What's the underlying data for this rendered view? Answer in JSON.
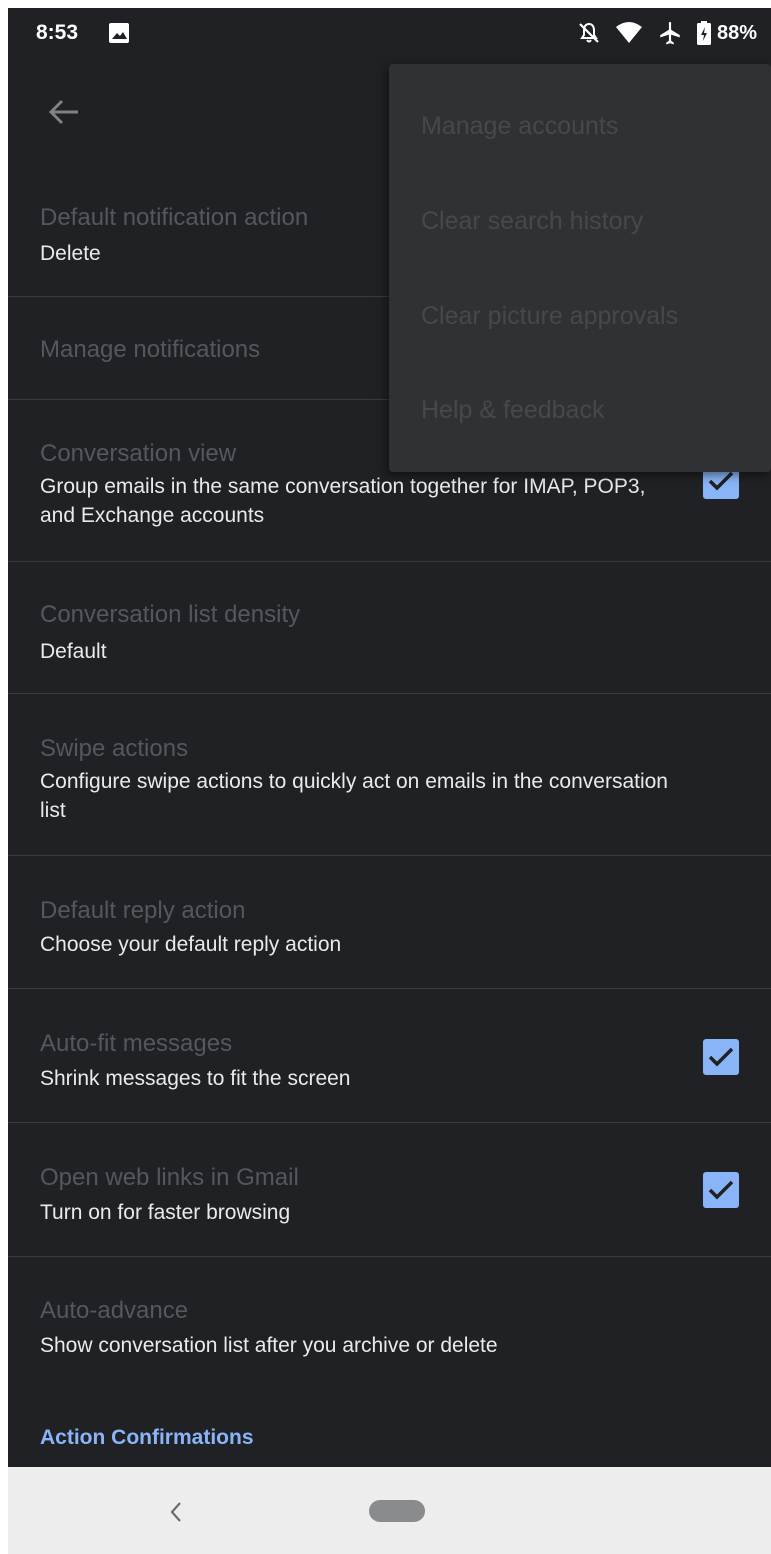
{
  "status_bar": {
    "time": "8:53",
    "battery": "88%",
    "icons": [
      "image-icon",
      "notifications-off-icon",
      "wifi-icon",
      "airplane-mode-icon",
      "battery-icon"
    ]
  },
  "app_bar": {
    "back_icon": "back-arrow-icon"
  },
  "settings": [
    {
      "title": "Default notification action",
      "subtitle": "Delete",
      "checkbox": null
    },
    {
      "title": "Manage notifications",
      "subtitle": "",
      "checkbox": null
    },
    {
      "title": "Conversation view",
      "subtitle": "Group emails in the same conversation together for IMAP, POP3, and Exchange accounts",
      "checkbox": true
    },
    {
      "title": "Conversation list density",
      "subtitle": "Default",
      "checkbox": null
    },
    {
      "title": "Swipe actions",
      "subtitle": "Configure swipe actions to quickly act on emails in the conversation list",
      "checkbox": null
    },
    {
      "title": "Default reply action",
      "subtitle": "Choose your default reply action",
      "checkbox": null
    },
    {
      "title": "Auto-fit messages",
      "subtitle": "Shrink messages to fit the screen",
      "checkbox": true
    },
    {
      "title": "Open web links in Gmail",
      "subtitle": "Turn on for faster browsing",
      "checkbox": true
    },
    {
      "title": "Auto-advance",
      "subtitle": "Show conversation list after you archive or delete",
      "checkbox": null
    }
  ],
  "section_header": "Action Confirmations",
  "overflow_menu": {
    "items": [
      "Manage accounts",
      "Clear search history",
      "Clear picture approvals",
      "Help & feedback"
    ]
  },
  "colors": {
    "background": "#202124",
    "accent": "#8ab4f8",
    "menu_background": "#303134",
    "nav_bar": "#ededee"
  }
}
